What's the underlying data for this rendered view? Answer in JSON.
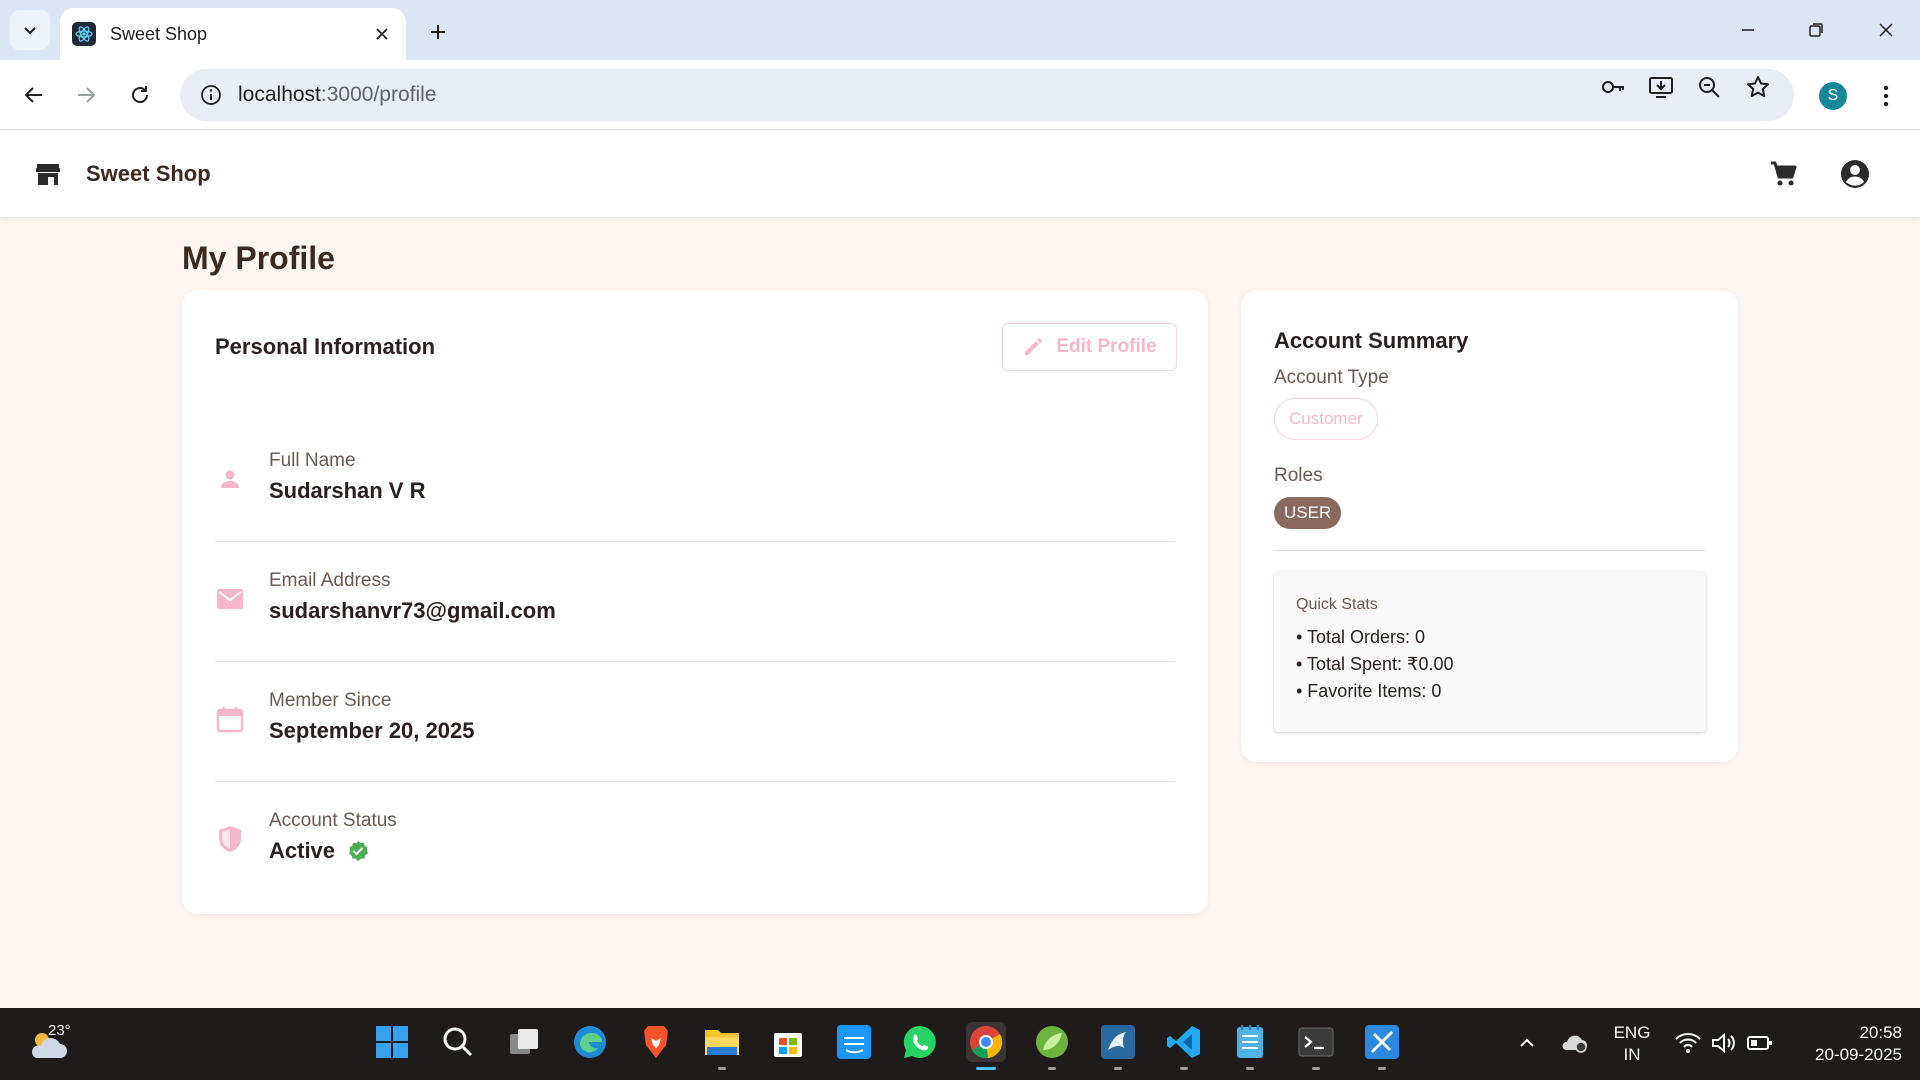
{
  "browser": {
    "tab_title": "Sweet Shop",
    "url_host": "localhost",
    "url_rest": ":3000/profile",
    "profile_initial": "S"
  },
  "app": {
    "brand": "Sweet Shop"
  },
  "page": {
    "title": "My Profile"
  },
  "personal": {
    "section_title": "Personal Information",
    "edit_label": "Edit Profile",
    "fields": [
      {
        "label": "Full Name",
        "value": "Sudarshan V R",
        "icon": "person-icon"
      },
      {
        "label": "Email Address",
        "value": "sudarshanvr73@gmail.com",
        "icon": "email-icon"
      },
      {
        "label": "Member Since",
        "value": "September 20, 2025",
        "icon": "calendar-icon"
      },
      {
        "label": "Account Status",
        "value": "Active",
        "icon": "shield-icon"
      }
    ]
  },
  "summary": {
    "title": "Account Summary",
    "account_type_label": "Account Type",
    "account_type": "Customer",
    "roles_label": "Roles",
    "role": "USER",
    "stats_title": "Quick Stats",
    "stats": [
      "• Total Orders: 0",
      "• Total Spent: ₹0.00",
      "• Favorite Items: 0"
    ]
  },
  "taskbar": {
    "temperature": "23°",
    "lang_top": "ENG",
    "lang_bottom": "IN",
    "time": "20:58",
    "date": "20-09-2025"
  },
  "colors": {
    "accent_pink": "#f5b7c9",
    "brown": "#8a6a5e",
    "page_bg": "#fcf5f0",
    "verified_green": "#4caf50"
  }
}
